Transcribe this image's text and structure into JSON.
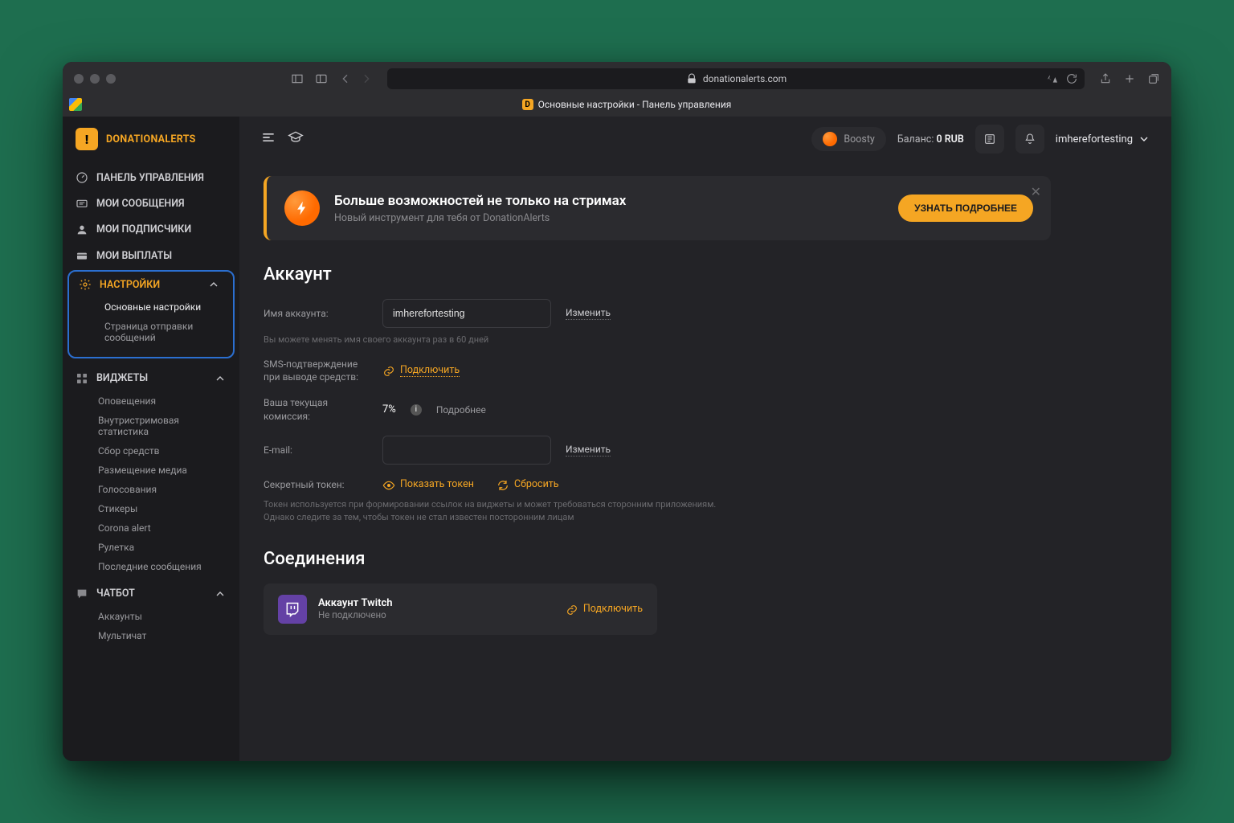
{
  "browser": {
    "domain": "donationalerts.com",
    "tab_title": "Основные настройки - Панель управления"
  },
  "brand": "DONATIONALERTS",
  "sidebar": {
    "items": [
      {
        "label": "ПАНЕЛЬ УПРАВЛЕНИЯ"
      },
      {
        "label": "МОИ СООБЩЕНИЯ"
      },
      {
        "label": "МОИ ПОДПИСЧИКИ"
      },
      {
        "label": "МОИ ВЫПЛАТЫ"
      }
    ],
    "settings": {
      "label": "НАСТРОЙКИ",
      "subs": [
        {
          "label": "Основные настройки",
          "active": true
        },
        {
          "label": "Страница отправки сообщений"
        }
      ]
    },
    "widgets": {
      "label": "ВИДЖЕТЫ",
      "subs": [
        "Оповещения",
        "Внутристримовая статистика",
        "Сбор средств",
        "Размещение медиа",
        "Голосования",
        "Стикеры",
        "Corona alert",
        "Рулетка",
        "Последние сообщения"
      ]
    },
    "chatbot": {
      "label": "ЧАТБОТ",
      "subs": [
        "Аккаунты",
        "Мультичат"
      ]
    }
  },
  "topbar": {
    "boosty": "Boosty",
    "balance_label": "Баланс:",
    "balance_value": "0 RUB",
    "username": "imherefortesting"
  },
  "promo": {
    "title": "Больше возможностей не только на стримах",
    "subtitle": "Новый инструмент для тебя от DonationAlerts",
    "cta": "УЗНАТЬ ПОДРОБНЕЕ"
  },
  "account": {
    "section_title": "Аккаунт",
    "name_label": "Имя аккаунта:",
    "name_value": "imherefortesting",
    "change": "Изменить",
    "name_hint": "Вы можете менять имя своего аккаунта раз в 60 дней",
    "sms_label": "SMS-подтверждение при выводе средств:",
    "sms_action": "Подключить",
    "fee_label": "Ваша текущая комиссия:",
    "fee_value": "7%",
    "fee_more": "Подробнее",
    "email_label": "E-mail:",
    "token_label": "Секретный токен:",
    "token_show": "Показать токен",
    "token_reset": "Сбросить",
    "token_hint1": "Токен используется при формировании ссылок на виджеты и может требоваться сторонним приложениям.",
    "token_hint2": "Однако следите за тем, чтобы токен не стал известен посторонним лицам"
  },
  "connections": {
    "section_title": "Соединения",
    "twitch_title": "Аккаунт Twitch",
    "twitch_status": "Не подключено",
    "connect": "Подключить"
  }
}
